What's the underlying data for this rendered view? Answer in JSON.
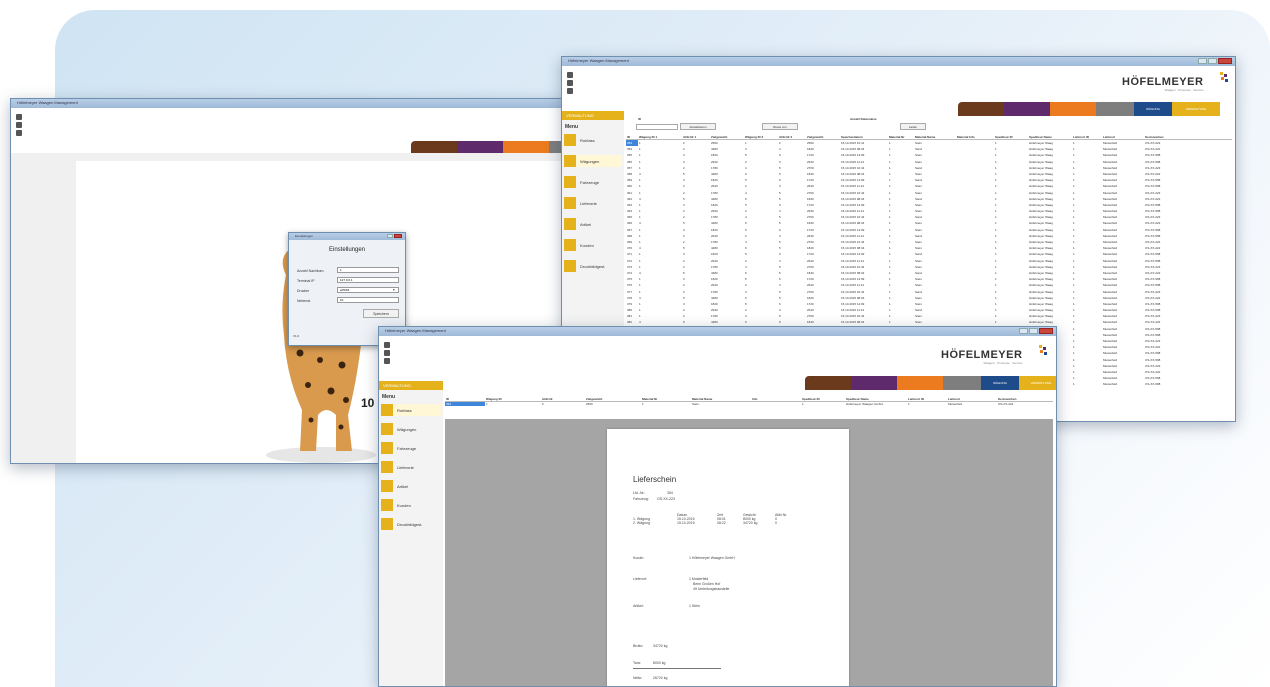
{
  "brand": {
    "name": "HÖFELMEYER",
    "tagline": "Waagen · Prozesse · Service",
    "colors": {
      "brown": "#6b3a1d",
      "purple": "#5e2a6b",
      "orange": "#ec7b20",
      "grey": "#7e7e7e",
      "blue": "#1e4c8a",
      "gold": "#e5b21b",
      "window_frame": "#6f8fb0"
    }
  },
  "app": {
    "sidebar_header": "VERWALTUNG",
    "menu_title": "Menu",
    "menu_items": [
      "Rohfass",
      "Wägungen",
      "Fahrzeuge",
      "Lieferorte",
      "Artikel",
      "Kunden",
      "Druckbildgest."
    ],
    "toolbar_tabs": {
      "blue": "WÄGUNG",
      "gold": "VERWALTUNG"
    }
  },
  "window_back": {
    "title": "Höfelmeyer Waagen Management"
  },
  "window_right": {
    "title": "Höfelmeyer Waagen Management",
    "search": {
      "id_label": "ID",
      "anzahl_label": "Anzahl Datensätze",
      "buttons": [
        "Aktualisieren",
        "Reset von",
        "Laden"
      ]
    },
    "grid": {
      "columns": [
        "ID",
        "Wägung ID 1",
        "Alibi Nr 1",
        "Zielgewicht",
        "Wägung ID 2",
        "Alibi Nr 2",
        "Zielgewicht",
        "Speicherdatum",
        "Material Nr",
        "Material Name",
        "Material Info",
        "Spediteur ID",
        "Spediteur Name",
        "Lieferort ID",
        "Lieferort",
        "Kennzeichen"
      ],
      "rows": [
        [
          "353",
          "1",
          "2",
          "2560",
          "1",
          "2",
          "2560",
          "15.10.2015 10:41",
          "1",
          "Stein",
          "",
          "1",
          "Höfelmeyer Waag",
          "1",
          "Musterfeld",
          "OS-XX-223"
        ],
        [
          "354",
          "1",
          "2",
          "4480",
          "3",
          "4",
          "1840",
          "15.10.2015 08:34",
          "1",
          "Sand",
          "",
          "1",
          "Höfelmeyer Waag",
          "1",
          "Musterfeld",
          "OS-XX-222"
        ],
        [
          "355",
          "1",
          "3",
          "1820",
          "5",
          "6",
          "1720",
          "15.10.2015 14:09",
          "1",
          "Stein",
          "",
          "1",
          "Höfelmeyer Waag",
          "1",
          "Musterfeld",
          "OS-XX-598"
        ],
        [
          "356",
          "1",
          "2",
          "2940",
          "2",
          "3",
          "2640",
          "15.10.2015 11:21",
          "1",
          "Stein",
          "",
          "1",
          "Höfelmeyer Waag",
          "1",
          "Musterfeld",
          "OS-XX-598"
        ],
        [
          "357",
          "1",
          "2",
          "1780",
          "4",
          "5",
          "2760",
          "15.10.2015 10:44",
          "1",
          "Sand",
          "",
          "1",
          "Höfelmeyer Waag",
          "1",
          "Musterfeld",
          "OS-XX-223"
        ],
        [
          "358",
          "4",
          "5",
          "4480",
          "6",
          "5",
          "1840",
          "15.10.2015 08:34",
          "1",
          "Stein",
          "",
          "1",
          "Höfelmeyer Waag",
          "1",
          "Musterfeld",
          "OS-XX-222"
        ],
        [
          "359",
          "1",
          "3",
          "1820",
          "5",
          "6",
          "1720",
          "15.10.2015 14:09",
          "1",
          "Sand",
          "",
          "1",
          "Höfelmeyer Waag",
          "1",
          "Musterfeld",
          "OS-XX-598"
        ],
        [
          "360",
          "1",
          "2",
          "2940",
          "2",
          "3",
          "2640",
          "15.10.2015 11:21",
          "1",
          "Stein",
          "",
          "1",
          "Höfelmeyer Waag",
          "1",
          "Musterfeld",
          "OS-XX-598"
        ],
        [
          "361",
          "1",
          "2",
          "1780",
          "4",
          "5",
          "2760",
          "15.10.2015 10:44",
          "1",
          "Stein",
          "",
          "1",
          "Höfelmeyer Waag",
          "1",
          "Musterfeld",
          "OS-XX-223"
        ],
        [
          "362",
          "4",
          "5",
          "4480",
          "6",
          "5",
          "1840",
          "15.10.2015 08:34",
          "1",
          "Sand",
          "",
          "1",
          "Höfelmeyer Waag",
          "1",
          "Musterfeld",
          "OS-XX-222"
        ],
        [
          "363",
          "1",
          "3",
          "1820",
          "5",
          "6",
          "1720",
          "15.10.2015 14:09",
          "1",
          "Stein",
          "",
          "1",
          "Höfelmeyer Waag",
          "1",
          "Musterfeld",
          "OS-XX-598"
        ],
        [
          "364",
          "1",
          "2",
          "2940",
          "2",
          "3",
          "2640",
          "15.10.2015 11:21",
          "1",
          "Stein",
          "",
          "1",
          "Höfelmeyer Waag",
          "1",
          "Musterfeld",
          "OS-XX-598"
        ],
        [
          "365",
          "1",
          "2",
          "1780",
          "4",
          "5",
          "2760",
          "15.10.2015 10:44",
          "1",
          "Sand",
          "",
          "1",
          "Höfelmeyer Waag",
          "1",
          "Musterfeld",
          "OS-XX-223"
        ],
        [
          "366",
          "4",
          "5",
          "4480",
          "6",
          "5",
          "1840",
          "15.10.2015 08:34",
          "1",
          "Stein",
          "",
          "1",
          "Höfelmeyer Waag",
          "1",
          "Musterfeld",
          "OS-XX-222"
        ],
        [
          "367",
          "1",
          "3",
          "1820",
          "5",
          "6",
          "1720",
          "15.10.2015 14:09",
          "1",
          "Stein",
          "",
          "1",
          "Höfelmeyer Waag",
          "1",
          "Musterfeld",
          "OS-XX-598"
        ],
        [
          "368",
          "1",
          "2",
          "2940",
          "2",
          "3",
          "2640",
          "15.10.2015 11:21",
          "1",
          "Sand",
          "",
          "1",
          "Höfelmeyer Waag",
          "1",
          "Musterfeld",
          "OS-XX-598"
        ],
        [
          "369",
          "1",
          "2",
          "1780",
          "4",
          "5",
          "2760",
          "15.10.2015 10:44",
          "1",
          "Stein",
          "",
          "1",
          "Höfelmeyer Waag",
          "1",
          "Musterfeld",
          "OS-XX-223"
        ],
        [
          "370",
          "4",
          "5",
          "4480",
          "6",
          "5",
          "1840",
          "15.10.2015 08:34",
          "1",
          "Stein",
          "",
          "1",
          "Höfelmeyer Waag",
          "1",
          "Musterfeld",
          "OS-XX-222"
        ],
        [
          "371",
          "1",
          "3",
          "1820",
          "5",
          "6",
          "1720",
          "15.10.2015 14:09",
          "1",
          "Sand",
          "",
          "1",
          "Höfelmeyer Waag",
          "1",
          "Musterfeld",
          "OS-XX-598"
        ],
        [
          "372",
          "1",
          "2",
          "2940",
          "2",
          "3",
          "2640",
          "15.10.2015 11:21",
          "1",
          "Stein",
          "",
          "1",
          "Höfelmeyer Waag",
          "1",
          "Musterfeld",
          "OS-XX-598"
        ],
        [
          "373",
          "1",
          "2",
          "1780",
          "4",
          "5",
          "2760",
          "15.10.2015 10:44",
          "1",
          "Stein",
          "",
          "1",
          "Höfelmeyer Waag",
          "1",
          "Musterfeld",
          "OS-XX-223"
        ],
        [
          "374",
          "4",
          "5",
          "4480",
          "6",
          "5",
          "1840",
          "15.10.2015 08:34",
          "1",
          "Sand",
          "",
          "1",
          "Höfelmeyer Waag",
          "1",
          "Musterfeld",
          "OS-XX-222"
        ],
        [
          "375",
          "1",
          "3",
          "1820",
          "5",
          "6",
          "1720",
          "15.10.2015 14:09",
          "1",
          "Stein",
          "",
          "1",
          "Höfelmeyer Waag",
          "1",
          "Musterfeld",
          "OS-XX-598"
        ],
        [
          "376",
          "1",
          "2",
          "2940",
          "2",
          "3",
          "2640",
          "15.10.2015 11:21",
          "1",
          "Stein",
          "",
          "1",
          "Höfelmeyer Waag",
          "1",
          "Musterfeld",
          "OS-XX-598"
        ],
        [
          "377",
          "1",
          "2",
          "1780",
          "4",
          "5",
          "2760",
          "15.10.2015 10:44",
          "1",
          "Sand",
          "",
          "1",
          "Höfelmeyer Waag",
          "1",
          "Musterfeld",
          "OS-XX-223"
        ],
        [
          "378",
          "4",
          "5",
          "4480",
          "6",
          "5",
          "1840",
          "15.10.2015 08:34",
          "1",
          "Stein",
          "",
          "1",
          "Höfelmeyer Waag",
          "1",
          "Musterfeld",
          "OS-XX-222"
        ],
        [
          "379",
          "1",
          "3",
          "1820",
          "5",
          "6",
          "1720",
          "15.10.2015 14:09",
          "1",
          "Stein",
          "",
          "1",
          "Höfelmeyer Waag",
          "1",
          "Musterfeld",
          "OS-XX-598"
        ],
        [
          "380",
          "1",
          "2",
          "2940",
          "2",
          "3",
          "2640",
          "15.10.2015 11:21",
          "1",
          "Sand",
          "",
          "1",
          "Höfelmeyer Waag",
          "1",
          "Musterfeld",
          "OS-XX-598"
        ],
        [
          "381",
          "1",
          "2",
          "1780",
          "4",
          "5",
          "2760",
          "15.10.2015 10:44",
          "1",
          "Stein",
          "",
          "1",
          "Höfelmeyer Waag",
          "1",
          "Musterfeld",
          "OS-XX-223"
        ],
        [
          "382",
          "4",
          "5",
          "4480",
          "6",
          "5",
          "1840",
          "15.10.2015 08:34",
          "1",
          "Stein",
          "",
          "1",
          "Höfelmeyer Waag",
          "1",
          "Musterfeld",
          "OS-XX-222"
        ],
        [
          "383",
          "1",
          "3",
          "1820",
          "5",
          "6",
          "1720",
          "15.10.2015 14:09",
          "1",
          "Sand",
          "",
          "1",
          "Höfelmeyer Waag",
          "1",
          "Musterfeld",
          "OS-XX-598"
        ],
        [
          "384",
          "1",
          "2",
          "2940",
          "2",
          "3",
          "2640",
          "15.10.2015 11:21",
          "1",
          "Stein",
          "",
          "1",
          "Höfelmeyer Waag",
          "1",
          "Musterfeld",
          "OS-XX-598"
        ],
        [
          "385",
          "1",
          "2",
          "1780",
          "4",
          "5",
          "2760",
          "15.10.2015 10:44",
          "1",
          "Stein",
          "",
          "1",
          "Höfelmeyer Waag",
          "1",
          "Musterfeld",
          "OS-XX-223"
        ],
        [
          "386",
          "4",
          "5",
          "4480",
          "6",
          "5",
          "1840",
          "15.10.2015 08:34",
          "1",
          "Sand",
          "",
          "1",
          "Höfelmeyer Waag",
          "1",
          "Musterfeld",
          "OS-XX-222"
        ],
        [
          "387",
          "1",
          "3",
          "1820",
          "5",
          "6",
          "1720",
          "15.10.2015 14:09",
          "1",
          "Stein",
          "",
          "1",
          "Höfelmeyer Waag",
          "1",
          "Musterfeld",
          "OS-XX-598"
        ],
        [
          "388",
          "1",
          "2",
          "2940",
          "2",
          "3",
          "2640",
          "15.10.2015 11:21",
          "1",
          "Stein",
          "",
          "1",
          "Höfelmeyer Waag",
          "1",
          "Musterfeld",
          "OS-XX-598"
        ],
        [
          "389",
          "1",
          "2",
          "1780",
          "4",
          "5",
          "2760",
          "15.10.2015 10:44",
          "1",
          "Sand",
          "",
          "1",
          "Höfelmeyer Waag",
          "1",
          "Musterfeld",
          "OS-XX-223"
        ],
        [
          "390",
          "4",
          "5",
          "4480",
          "6",
          "5",
          "1840",
          "15.10.2015 08:34",
          "1",
          "Stein",
          "",
          "1",
          "Höfelmeyer Waag",
          "1",
          "Musterfeld",
          "OS-XX-222"
        ],
        [
          "391",
          "1",
          "3",
          "1820",
          "5",
          "6",
          "1720",
          "15.10.2015 14:09",
          "1",
          "Stein",
          "",
          "1",
          "Höfelmeyer Waag",
          "1",
          "Musterfeld",
          "OS-XX-598"
        ],
        [
          "392",
          "1",
          "2",
          "2940",
          "2",
          "3",
          "2640",
          "15.10.2015 11:21",
          "1",
          "Sand",
          "",
          "1",
          "Höfelmeyer Waag",
          "1",
          "Musterfeld",
          "OS-XX-598"
        ]
      ]
    }
  },
  "window_front": {
    "title": "Höfelmeyer Waagen Management",
    "grid": {
      "columns": [
        "ID",
        "Wägung ID",
        "Alibi Nr",
        "Zielgewicht",
        "Material Nr",
        "Material Name",
        "Info",
        "Spediteur ID",
        "Spediteur Name",
        "Lieferort ID",
        "Lieferort",
        "Kennzeichen"
      ],
      "row": [
        "354",
        "1",
        "2",
        "2560",
        "1",
        "Stein",
        "",
        "1",
        "Höfelmeyer Waagen GmbH",
        "1",
        "Musterfeld",
        "OS-XX-223"
      ]
    },
    "lieferschein": {
      "title": "Lieferschein",
      "lfs_label": "Lfd.-Nr.:",
      "lfs_value": "354",
      "fahrzeug_label": "Fahrzeug:",
      "fahrzeug_value": "OS-XX-223",
      "table_headers": [
        "",
        "Datum",
        "Zeit",
        "Gewicht",
        "Alibi Nr."
      ],
      "table_rows": [
        [
          "1. Wägung",
          "15.10.2015",
          "08:01",
          "8000 kg",
          "0"
        ],
        [
          "2. Wägung",
          "15.10.2015",
          "08:22",
          "34720 kg",
          "0"
        ]
      ],
      "kunde_label": "Kunde:",
      "kunde_value": "1   Höfelmeyer Waagen GmbH",
      "lieferort_label": "Lieferort:",
      "lieferort_lines": [
        "1   Musterfeld",
        "Beim Großen Hof",
        "49 Umleitungsbaustelle"
      ],
      "artikel_label": "Artikel:",
      "artikel_value": "1   Stein",
      "brutto_label": "Brutto:",
      "brutto_value": "34720 kg",
      "tara_label": "Tara:",
      "tara_value": "8000 kg",
      "netto_label": "Netto:",
      "netto_value": "26720 kg"
    }
  },
  "dialog": {
    "title": "Einstellungen",
    "window_title": "Einstellungen",
    "fields": [
      {
        "label": "Anzahl Nachkom.",
        "value": "1"
      },
      {
        "label": "Terminal IP",
        "value": "127.0.0.1"
      },
      {
        "label": "Drucker",
        "value": "ePDF6"
      },
      {
        "label": "Nebenst.",
        "value": "10"
      }
    ],
    "save_label": "Speichern",
    "version": "V1.0"
  },
  "back_number": "10"
}
